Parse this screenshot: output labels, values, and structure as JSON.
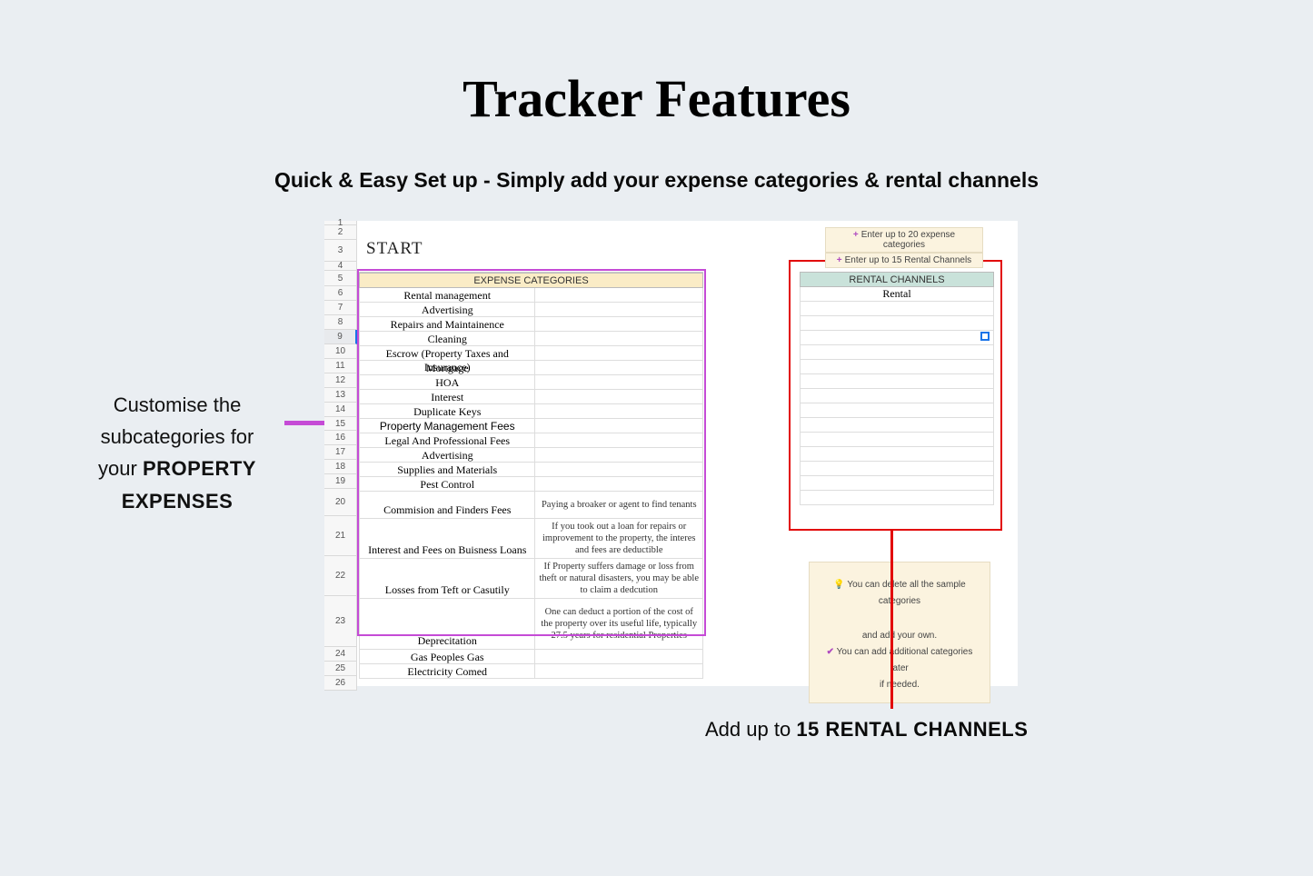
{
  "title": "Tracker Features",
  "subtitle": "Quick & Easy Set up - Simply add your expense categories & rental channels",
  "leftCaption": {
    "line1": "Customise the",
    "line2": "subcategories for",
    "line3_pre": "your ",
    "line3_bold": "PROPERTY",
    "line4_bold": "EXPENSES"
  },
  "bottomCaption": {
    "pre": "Add up to ",
    "bold": "15 RENTAL CHANNELS"
  },
  "sheet": {
    "startLabel": "START",
    "rowNumbers": [
      "1",
      "2",
      "3",
      "4",
      "5",
      "6",
      "7",
      "8",
      "9",
      "10",
      "11",
      "12",
      "13",
      "14",
      "15",
      "16",
      "17",
      "18",
      "19",
      "20",
      "21",
      "22",
      "23",
      "24",
      "25",
      "26"
    ],
    "selectedRow": "9",
    "expenseHeader": "EXPENSE CATEGORIES",
    "expenses": [
      {
        "name": "Rental management",
        "desc": ""
      },
      {
        "name": "Advertising",
        "desc": ""
      },
      {
        "name": "Repairs and Maintainence",
        "desc": ""
      },
      {
        "name": "Cleaning",
        "desc": ""
      },
      {
        "name": "Escrow (Property Taxes and Insurance)",
        "desc": ""
      },
      {
        "name": "Mortgage",
        "desc": ""
      },
      {
        "name": "HOA",
        "desc": ""
      },
      {
        "name": "Interest",
        "desc": ""
      },
      {
        "name": "Duplicate Keys",
        "desc": ""
      },
      {
        "name": "Property Management Fees",
        "desc": ""
      },
      {
        "name": "Legal And Professional Fees",
        "desc": ""
      },
      {
        "name": "Advertising",
        "desc": ""
      },
      {
        "name": "Supplies and Materials",
        "desc": ""
      },
      {
        "name": "Pest Control",
        "desc": ""
      },
      {
        "name": "Commision and Finders Fees",
        "desc": "Paying a broaker or agent to find tenants"
      },
      {
        "name": "Interest and Fees on Buisness Loans",
        "desc": "If you took out a loan for repairs or improvement to the property, the interes and fees are deductible"
      },
      {
        "name": "Losses from Teft or Casutily",
        "desc": "If Property suffers damage or loss from theft or natural disasters, you may be able to claim a dedcution"
      },
      {
        "name": "Deprecitation",
        "desc": "One can deduct a portion of the cost of the property over its useful life, typically 27.5 years for residential Properties"
      },
      {
        "name": "Gas Peoples Gas",
        "desc": ""
      },
      {
        "name": "Electricity Comed",
        "desc": ""
      }
    ],
    "rentalHeader": "RENTAL CHANNELS",
    "rentals": [
      "Rental",
      "",
      "",
      "",
      "",
      "",
      "",
      "",
      "",
      "",
      "",
      "",
      "",
      "",
      ""
    ],
    "hintsTop": [
      "Enter up to 20 expense categories",
      "Enter up to 15 Rental Channels"
    ],
    "hintsBottom": {
      "line1": "You can delete all the sample categories",
      "line2": "and add your own.",
      "line3": "You can add additional categories later",
      "line4": "if needed."
    }
  }
}
